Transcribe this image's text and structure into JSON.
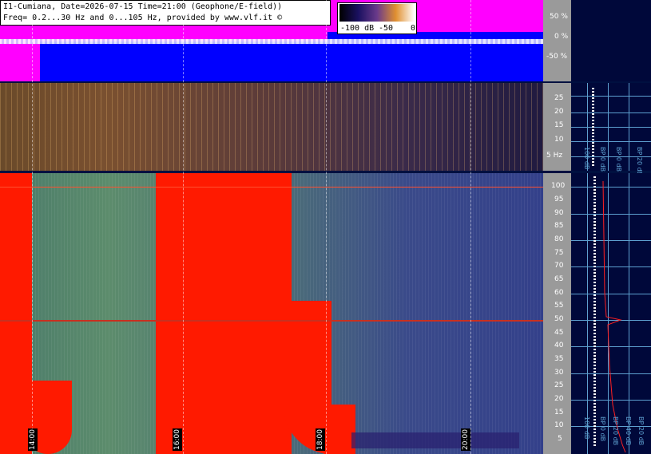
{
  "header": {
    "line1": "I1-Cumiana, Date=2026-07-15 Time=21:00 (Geophone/E-field))",
    "line2": "Freq= 0.2...30 Hz and 0...105 Hz, provided by www.vlf.it ©"
  },
  "colorbar": {
    "min_label": "-100 dB",
    "mid_label": "-50",
    "max_label": "0"
  },
  "top_axis": {
    "ticks": [
      "50 %",
      "0 %",
      "-50 %"
    ]
  },
  "mid_axis": {
    "ticks": [
      "25",
      "20",
      "15",
      "10",
      "5 Hz"
    ]
  },
  "spec_axis": {
    "ticks": [
      "100",
      "95",
      "90",
      "85",
      "80",
      "75",
      "70",
      "65",
      "60",
      "55",
      "50",
      "45",
      "40",
      "35",
      "30",
      "25",
      "20",
      "15",
      "10",
      "5"
    ]
  },
  "time_labels": [
    "14:00",
    "16:00",
    "18:00",
    "20:00"
  ],
  "right_mid_labels": [
    "100 dB",
    "BP 0 dB",
    "BP 0 dB",
    "BP 20 dB"
  ],
  "right_spec_labels": [
    "100 dB",
    "BP 0 dB",
    "BP 20 dB",
    "BP 40 dB",
    "BP 20 dB"
  ],
  "colors": {
    "magenta": "#ff00ff",
    "blue": "#0000ff",
    "red": "#ff1a00",
    "grid": "#5da0d0"
  }
}
